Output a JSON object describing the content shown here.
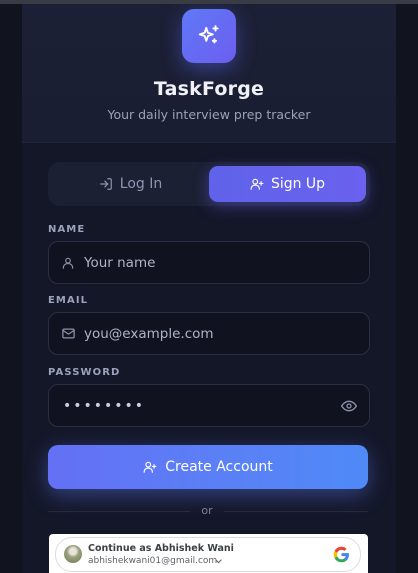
{
  "app": {
    "title": "TaskForge",
    "subtitle": "Your daily interview prep tracker",
    "logo_icon": "sparkles-icon"
  },
  "tabs": [
    {
      "label": "Log In",
      "icon": "login-icon",
      "active": false
    },
    {
      "label": "Sign Up",
      "icon": "user-plus-icon",
      "active": true
    }
  ],
  "form": {
    "name": {
      "label": "NAME",
      "placeholder": "Your name",
      "icon": "user-icon"
    },
    "email": {
      "label": "EMAIL",
      "placeholder": "you@example.com",
      "icon": "mail-icon"
    },
    "password": {
      "label": "PASSWORD",
      "value": "••••••••",
      "icon": "eye-icon"
    },
    "submit_label": "Create Account"
  },
  "divider_text": "or",
  "google": {
    "continue_text": "Continue as Abhishek Wani",
    "email": "abhishekwani01@gmail.com"
  },
  "colors": {
    "background": "#0a0c16",
    "card": "#141728",
    "accent": "#6366f1",
    "cta_start": "#6470f5",
    "cta_end": "#4f8af7"
  }
}
